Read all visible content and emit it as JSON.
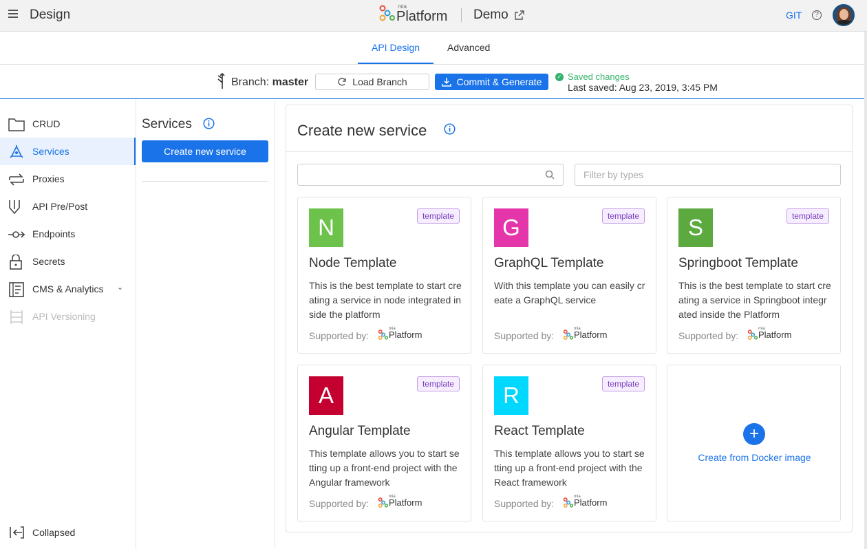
{
  "topbar": {
    "app_title": "Design",
    "logo_mia": "mia",
    "logo_text": "Platform",
    "project": "Demo",
    "git": "GIT",
    "help": "?"
  },
  "tabs": [
    {
      "label": "API Design",
      "active": true
    },
    {
      "label": "Advanced",
      "active": false
    }
  ],
  "branchbar": {
    "branch_prefix": "Branch:",
    "branch_name": "master",
    "load_label": "Load Branch",
    "commit_label": "Commit & Generate",
    "saved_title": "Saved changes",
    "saved_time": "Last saved:  Aug 23, 2019, 3:45 PM"
  },
  "sidebar": {
    "items": [
      {
        "label": "CRUD",
        "icon": "folder-icon",
        "active": false,
        "disabled": false
      },
      {
        "label": "Services",
        "icon": "services-icon",
        "active": true,
        "disabled": false
      },
      {
        "label": "Proxies",
        "icon": "proxies-icon",
        "active": false,
        "disabled": false
      },
      {
        "label": "API Pre/Post",
        "icon": "decorator-icon",
        "active": false,
        "disabled": false
      },
      {
        "label": "Endpoints",
        "icon": "endpoint-icon",
        "active": false,
        "disabled": false
      },
      {
        "label": "Secrets",
        "icon": "lock-icon",
        "active": false,
        "disabled": false
      },
      {
        "label": "CMS & Analytics",
        "icon": "cms-icon",
        "active": false,
        "disabled": false
      },
      {
        "label": "API Versioning",
        "icon": "versioning-icon",
        "active": false,
        "disabled": true
      }
    ],
    "collapsed_label": "Collapsed"
  },
  "mid": {
    "title": "Services",
    "create_label": "Create new service"
  },
  "main": {
    "title": "Create new service",
    "search_placeholder": "",
    "filter_placeholder": "Filter by types",
    "supported_by": "Supported by:",
    "supported_logo_mia": "mia",
    "supported_logo_text": "Platform",
    "cards": [
      {
        "letter": "N",
        "color": "#6cc24a",
        "tag": "template",
        "title": "Node Template",
        "desc": "This is the best template to start creating a service in node integrated inside the platform"
      },
      {
        "letter": "G",
        "color": "#e535ab",
        "tag": "template",
        "title": "GraphQL Template",
        "desc": "With this template you can easily create a GraphQL service"
      },
      {
        "letter": "S",
        "color": "#5ba93f",
        "tag": "template",
        "title": "Springboot Template",
        "desc": "This is the best template to start creating a service in Springboot integrated inside the Platform"
      },
      {
        "letter": "A",
        "color": "#c3002f",
        "tag": "template",
        "title": "Angular Template",
        "desc": "This template allows you to start setting up a front-end project with the Angular framework"
      },
      {
        "letter": "R",
        "color": "#00d8ff",
        "tag": "template",
        "title": "React Template",
        "desc": "This template allows you to start setting up a front-end project with the React framework"
      }
    ],
    "docker_label": "Create from Docker image",
    "docker_plus": "+"
  }
}
